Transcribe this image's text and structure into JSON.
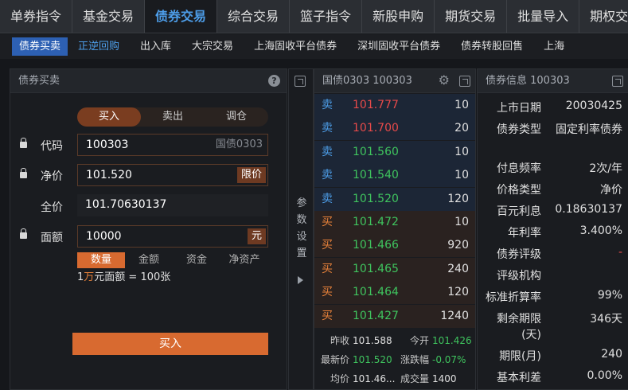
{
  "top_tabs": [
    "单券指令",
    "基金交易",
    "债券交易",
    "综合交易",
    "篮子指令",
    "新股申购",
    "期货交易",
    "批量导入",
    "期权交易"
  ],
  "top_tab_active": 2,
  "sub_tabs": [
    "债券买卖",
    "正逆回购",
    "出入库",
    "大宗交易",
    "上海固收平台债券",
    "深圳固收平台债券",
    "债券转股回售",
    "上海"
  ],
  "trade_panel": {
    "title": "债券买卖",
    "help": "?",
    "direction": [
      "买入",
      "卖出",
      "调仓"
    ],
    "code_label": "代码",
    "code_value": "100303",
    "code_hint": "国债0303",
    "net_price_label": "净价",
    "net_price_value": "101.520",
    "limit_label": "限价",
    "full_price_label": "全价",
    "full_price_value": "101.70630137",
    "face_label": "面额",
    "face_value": "10000",
    "unit_label": "元",
    "qty_tabs": [
      "数量",
      "金额",
      "资金",
      "净资产"
    ],
    "note_prefix": "1",
    "note_red": "万",
    "note_suffix": "元面额 = 100张",
    "buy_button": "买入"
  },
  "param_strip": {
    "label": "参数设置"
  },
  "order_book": {
    "title": "国债0303 100303",
    "asks": [
      {
        "side": "卖",
        "price": "101.777",
        "vol": "10",
        "color": "#e84a4a"
      },
      {
        "side": "卖",
        "price": "101.700",
        "vol": "20",
        "color": "#e84a4a"
      },
      {
        "side": "卖",
        "price": "101.560",
        "vol": "10",
        "color": "#3fc45e"
      },
      {
        "side": "卖",
        "price": "101.540",
        "vol": "10",
        "color": "#3fc45e"
      },
      {
        "side": "卖",
        "price": "101.520",
        "vol": "120",
        "color": "#3fc45e"
      }
    ],
    "bids": [
      {
        "side": "买",
        "price": "101.472",
        "vol": "10",
        "color": "#3fc45e"
      },
      {
        "side": "买",
        "price": "101.466",
        "vol": "920",
        "color": "#3fc45e"
      },
      {
        "side": "买",
        "price": "101.465",
        "vol": "240",
        "color": "#3fc45e"
      },
      {
        "side": "买",
        "price": "101.464",
        "vol": "120",
        "color": "#3fc45e"
      },
      {
        "side": "买",
        "price": "101.427",
        "vol": "1240",
        "color": "#3fc45e"
      }
    ],
    "summary": {
      "prev_close_label": "昨收",
      "prev_close": "101.588",
      "open_label": "今开",
      "open": "101.426",
      "last_label": "最新价",
      "last": "101.520",
      "change_label": "涨跌幅",
      "change": "-0.07%",
      "avg_label": "均价",
      "avg": "101.46...",
      "volume_label": "成交量",
      "volume": "1400"
    }
  },
  "bond_info": {
    "title": "债券信息 100303",
    "rows": [
      {
        "k": "上市日期",
        "v": "20030425"
      },
      {
        "k": "债券类型",
        "v": "固定利率债券"
      },
      {
        "k": "付息频率",
        "v": "2次/年"
      },
      {
        "k": "价格类型",
        "v": "净价"
      },
      {
        "k": "百元利息",
        "v": "0.18630137"
      },
      {
        "k": "年利率",
        "v": "3.400%"
      },
      {
        "k": "债券评级",
        "v": "-"
      },
      {
        "k": "评级机构",
        "v": ""
      },
      {
        "k": "标准折算率",
        "v": "99%"
      },
      {
        "k": "剩余期限(天)",
        "v": "346天"
      },
      {
        "k": "期限(月)",
        "v": "240"
      },
      {
        "k": "基本利差",
        "v": "0.00%"
      }
    ]
  },
  "colors": {
    "accent": "#4d9de8",
    "buy": "#d86a30",
    "down": "#3fc45e",
    "up": "#e84a4a"
  }
}
